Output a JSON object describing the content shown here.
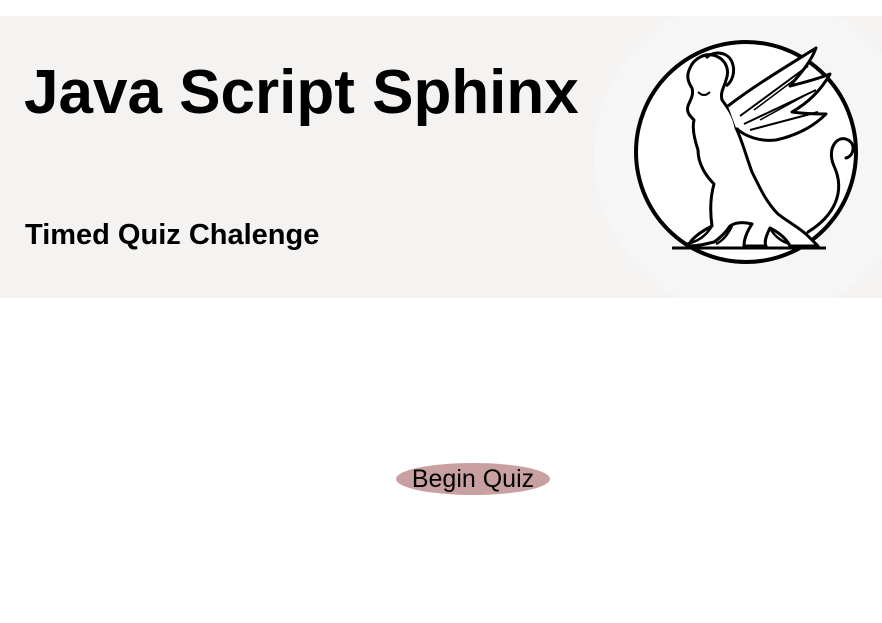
{
  "header": {
    "title": "Java Script Sphinx",
    "subtitle": "Timed Quiz Chalenge",
    "logo_icon": "sphinx-logo-icon"
  },
  "main": {
    "begin_button_label": "Begin Quiz"
  },
  "colors": {
    "header_bg": "#f4f3f2",
    "button_bg": "#c9a0a2"
  }
}
